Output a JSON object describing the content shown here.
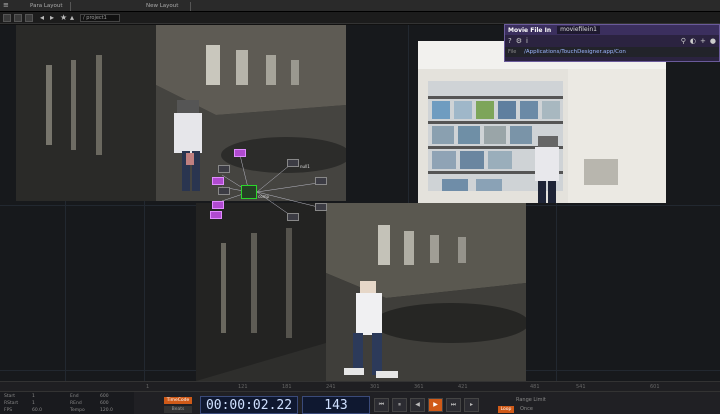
{
  "top_tabs": [
    "Para Layout",
    "New Layout"
  ],
  "toolbar": {
    "path": "/ project1"
  },
  "param_panel": {
    "op_type": "Movie File In",
    "op_name": "moviefilein1",
    "file_label": "File",
    "file_value": "/Applications/TouchDesigner.app/Con"
  },
  "ruler_ticks": [
    "1",
    "121",
    "181",
    "241",
    "301",
    "361",
    "421",
    "481",
    "541",
    "601"
  ],
  "range": {
    "start_label": "Start",
    "start_value": "1",
    "rstart_label": "RStart",
    "rstart_value": "1",
    "fps_label": "FPS",
    "fps_value": "60.0",
    "end_label": "End",
    "end_value": "600",
    "rend_label": "REnd",
    "rend_value": "600",
    "tempo_label": "Tempo",
    "tempo_value": "120.0"
  },
  "timecode_button": "TimeCode",
  "beats_button": "Beats",
  "timecode": "00:00:02.22",
  "frame": "143",
  "transport": [
    "⏮",
    "⏸",
    "◀",
    "▶",
    "⏭",
    "▸"
  ],
  "range_limit_label": "Range Limit",
  "loop_button": "Loop",
  "once_label": "Once",
  "nodes": [
    "moviefile",
    "mask",
    "null1",
    "comp",
    "out1"
  ],
  "colors": {
    "accent": "#d05a18",
    "select": "#2bd62b",
    "panel": "#3b2f5e"
  }
}
